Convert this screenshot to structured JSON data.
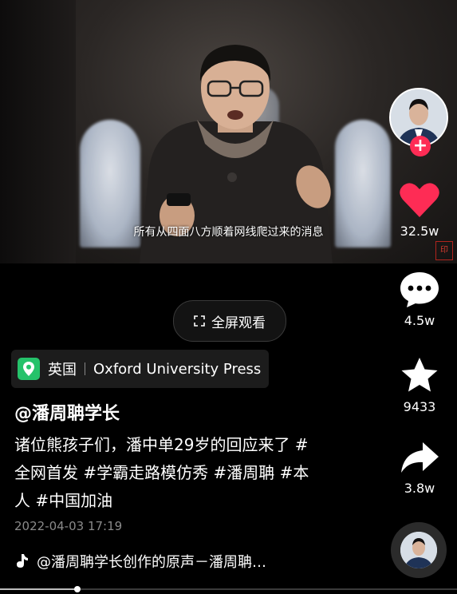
{
  "video": {
    "subtitle": "所有从四面八方顺着网线爬过来的消息",
    "progress_fraction": 0.17
  },
  "fullscreen_button": {
    "label": "全屏观看",
    "icon": "fullscreen-icon"
  },
  "location_tag": {
    "country": "英国",
    "place": "Oxford University Press",
    "icon": "location-pin-icon"
  },
  "post": {
    "handle": "@潘周聃学长",
    "description": " 诸位熊孩子们，潘中单29岁的回应来了 #全网首发 #学霸走路模仿秀 #潘周聃 #本人 #中国加油",
    "date": "2022-04-03 17:19",
    "music": "@潘周聃学长创作的原声－潘周聃…"
  },
  "actions": {
    "like": {
      "count": "32.5w",
      "icon": "heart-icon",
      "color": "#fe2c55"
    },
    "comment": {
      "count": "4.5w",
      "icon": "comment-icon"
    },
    "favorite": {
      "count": "9433",
      "icon": "star-icon"
    },
    "share": {
      "count": "3.8w",
      "icon": "share-icon"
    }
  },
  "colors": {
    "accent": "#fe2c55",
    "location_pin": "#25c26a"
  }
}
